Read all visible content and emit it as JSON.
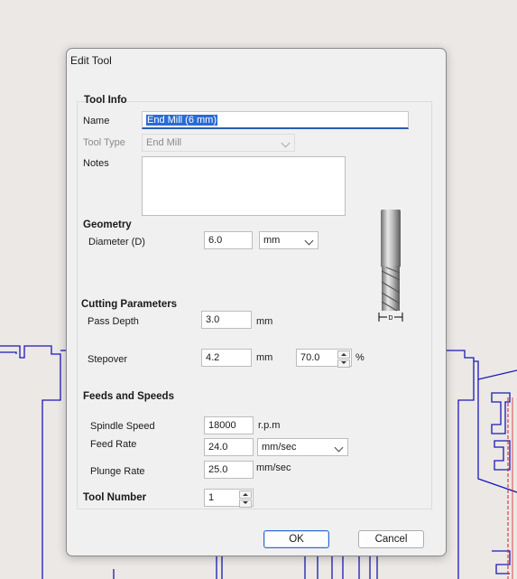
{
  "dialog": {
    "title": "Edit Tool"
  },
  "tool_info": {
    "header": "Tool Info",
    "name_label": "Name",
    "name_value": "End Mill (6 mm)",
    "tool_type_label": "Tool Type",
    "tool_type_value": "End Mill",
    "notes_label": "Notes",
    "notes_value": ""
  },
  "geometry": {
    "header": "Geometry",
    "diameter_label": "Diameter (D)",
    "diameter_value": "6.0",
    "diameter_unit": "mm",
    "diagram_label": "D"
  },
  "cutting": {
    "header": "Cutting Parameters",
    "pass_depth_label": "Pass Depth",
    "pass_depth_value": "3.0",
    "pass_depth_unit": "mm",
    "stepover_label": "Stepover",
    "stepover_value": "4.2",
    "stepover_unit": "mm",
    "stepover_percent_value": "70.0",
    "percent_symbol": "%"
  },
  "feeds": {
    "header": "Feeds and Speeds",
    "spindle_label": "Spindle Speed",
    "spindle_value": "18000",
    "spindle_unit": "r.p.m",
    "feed_label": "Feed Rate",
    "feed_value": "24.0",
    "feed_unit": "mm/sec",
    "plunge_label": "Plunge Rate",
    "plunge_value": "25.0",
    "plunge_unit": "mm/sec"
  },
  "tool_number": {
    "label": "Tool Number",
    "value": "1"
  },
  "buttons": {
    "ok": "OK",
    "cancel": "Cancel"
  },
  "colors": {
    "accent": "#2a6ad6",
    "drawing_lines": "#1a1ab4",
    "drawing_red": "#d42020"
  }
}
